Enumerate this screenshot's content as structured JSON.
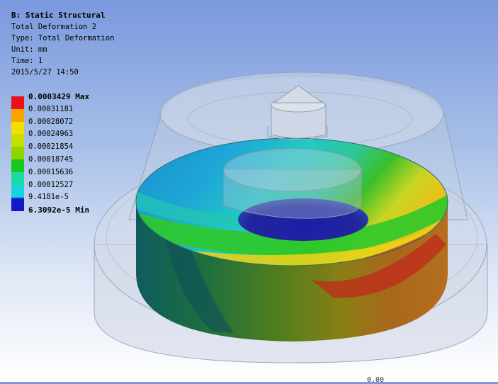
{
  "header": {
    "title": "B: Static Structural",
    "result_name": "Total Deformation 2",
    "type_line": "Type: Total Deformation",
    "unit_line": "Unit: mm",
    "time_line": "Time: 1",
    "date_line": "2015/5/27 14:50"
  },
  "legend": {
    "items": [
      {
        "label": "0.0003429 Max",
        "color": "#e8121a",
        "bold": true
      },
      {
        "label": "0.00031181",
        "color": "#f7a600"
      },
      {
        "label": "0.00028072",
        "color": "#f3e000"
      },
      {
        "label": "0.00024963",
        "color": "#c8e000"
      },
      {
        "label": "0.00021854",
        "color": "#8fd500"
      },
      {
        "label": "0.00018745",
        "color": "#14c81c"
      },
      {
        "label": "0.00015636",
        "color": "#1ed8a4"
      },
      {
        "label": "0.00012527",
        "color": "#19d3de"
      },
      {
        "label": "9.4181e-5",
        "color": "#1294e0"
      },
      {
        "label": "6.3092e-5 Min",
        "color": "#1018c8",
        "bold": true
      }
    ]
  },
  "scale_stub": "0.00"
}
